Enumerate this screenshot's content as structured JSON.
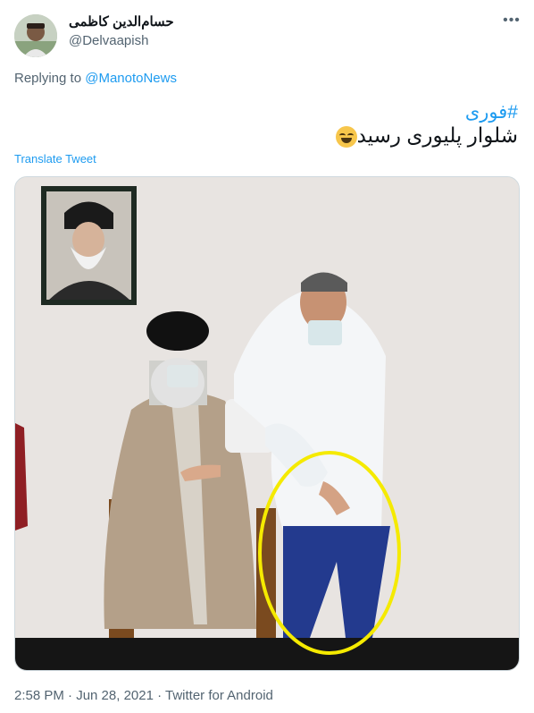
{
  "user": {
    "display_name": "حسام‌الدین کاظمی",
    "handle": "@Delvaapish"
  },
  "reply": {
    "prefix": "Replying to",
    "mention": "@ManotoNews"
  },
  "tweet": {
    "hashtag": "#فوری",
    "text": "شلوار پلیوری رسید",
    "emoji": "face-with-tears-of-joy",
    "translate_label": "Translate Tweet"
  },
  "footer": {
    "meta": "2:58 PM · Jun 28, 2021 · Twitter for Android"
  },
  "icons": {
    "more": "more-options-icon"
  },
  "colors": {
    "link": "#1d9bf0",
    "secondary": "#536471",
    "text": "#0f1419",
    "highlight_circle": "#f5ea00"
  }
}
